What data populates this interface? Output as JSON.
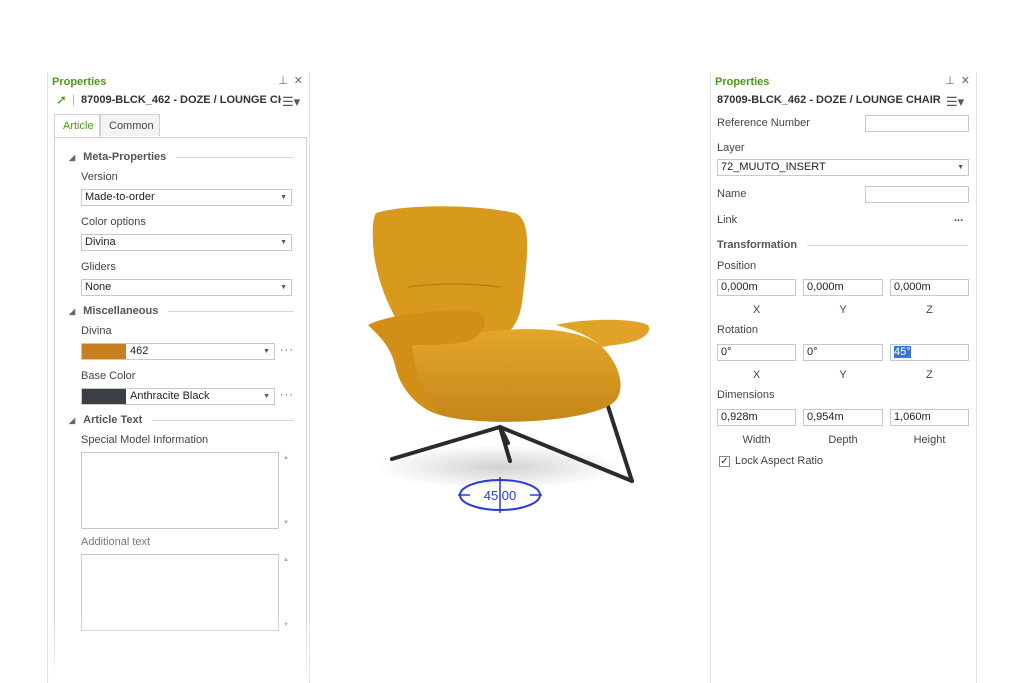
{
  "left_panel": {
    "title": "Properties",
    "pin_icon": "pin-icon",
    "close_icon": "close-icon",
    "subtitle": "87009-BLCK_462 - DOZE / LOUNGE CH...",
    "tabs": [
      {
        "label": "Article"
      },
      {
        "label": "Common"
      }
    ],
    "sections": {
      "meta": "Meta-Properties",
      "misc": "Miscellaneous",
      "text": "Article Text"
    },
    "version": {
      "label": "Version",
      "value": "Made-to-order"
    },
    "color_options": {
      "label": "Color options",
      "value": "Divina"
    },
    "gliders": {
      "label": "Gliders",
      "value": "None"
    },
    "divina": {
      "label": "Divina",
      "value": "462",
      "swatch": "#c8801e"
    },
    "base_color": {
      "label": "Base Color",
      "value": "Anthracite Black",
      "swatch": "#3b3e44"
    },
    "special_info": {
      "label": "Special Model Information",
      "value": ""
    },
    "additional_text": {
      "label": "Additional text",
      "value": ""
    }
  },
  "right_panel": {
    "title": "Properties",
    "subtitle": "87009-BLCK_462 - DOZE / LOUNGE CHAIR",
    "reference_number": {
      "label": "Reference Number",
      "value": ""
    },
    "layer": {
      "label": "Layer",
      "value": "72_MUUTO_INSERT"
    },
    "name": {
      "label": "Name",
      "value": ""
    },
    "link": {
      "label": "Link",
      "dots": "..."
    },
    "transformation": "Transformation",
    "position": {
      "label": "Position",
      "x": "0,000m",
      "y": "0,000m",
      "z": "0,000m"
    },
    "rotation": {
      "label": "Rotation",
      "x": "0°",
      "y": "0°",
      "z": "45°"
    },
    "dimensions": {
      "label": "Dimensions",
      "width": "0,928m",
      "depth": "0,954m",
      "height": "1,060m"
    },
    "axes": {
      "x": "X",
      "y": "Y",
      "z": "Z"
    },
    "dim_labels": {
      "width": "Width",
      "depth": "Depth",
      "height": "Height"
    },
    "lock_aspect": {
      "label": "Lock Aspect Ratio",
      "checked": true
    }
  },
  "viewport": {
    "rotation_value": "45,00",
    "chair_color": "#d89a1c",
    "leg_color": "#2b2b2b",
    "handle_color": "#2a3ad6"
  }
}
